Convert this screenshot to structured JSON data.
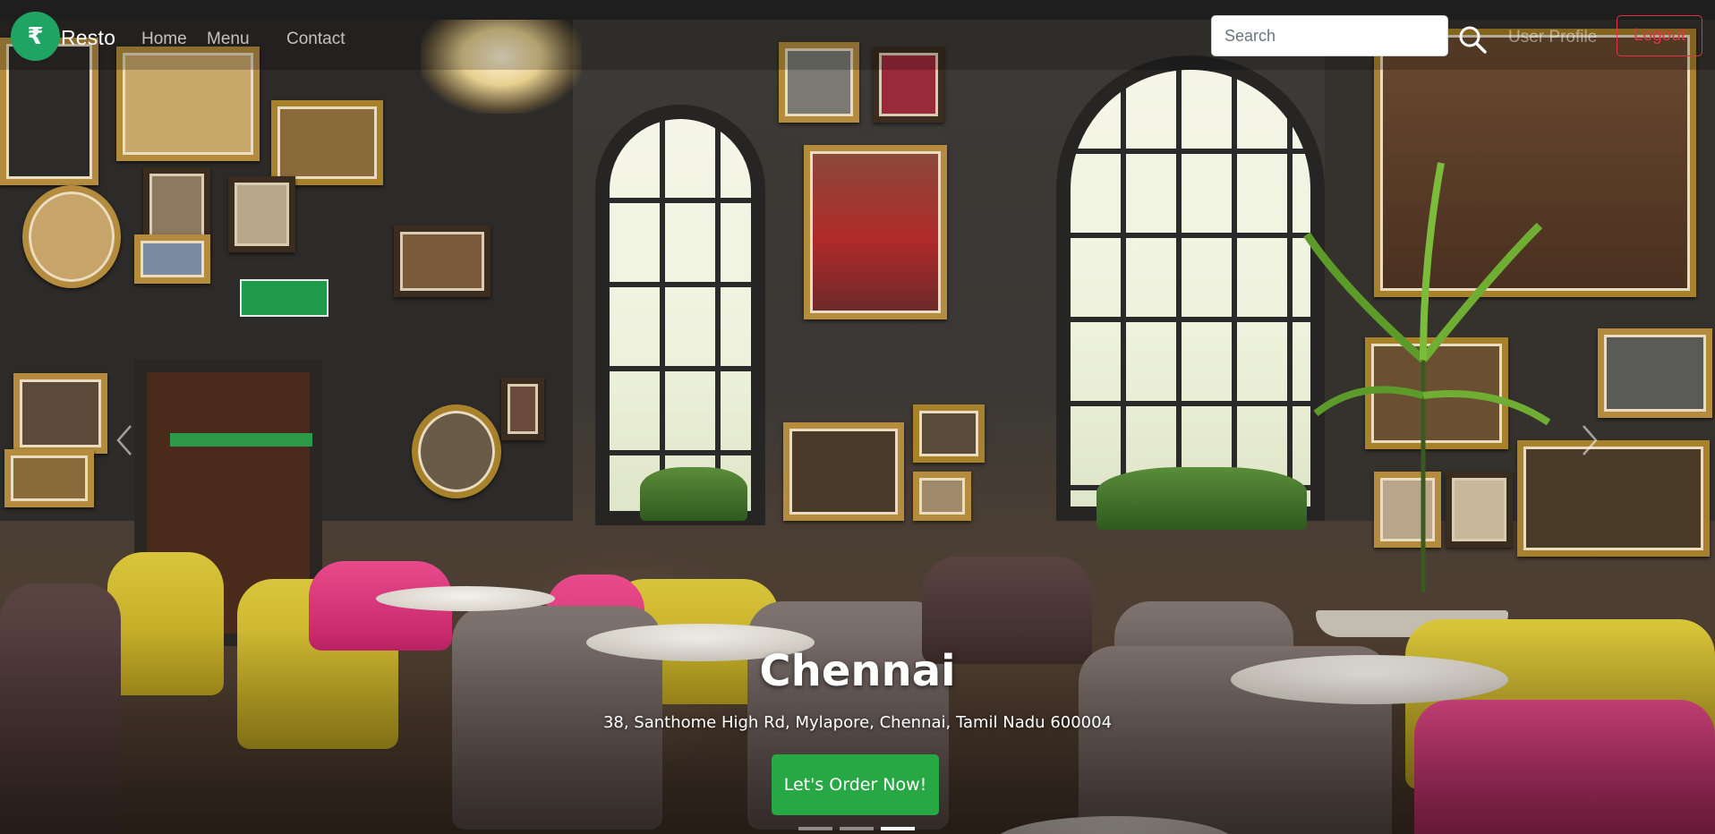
{
  "brand": {
    "name": "Resto",
    "logo_glyph": "₹",
    "logo_color": "#1fa463"
  },
  "nav": {
    "items": [
      {
        "label": "Home"
      },
      {
        "label": "Menu"
      },
      {
        "label": "Contact"
      }
    ]
  },
  "search": {
    "placeholder": "Search",
    "value": "",
    "icon": "search-icon"
  },
  "user": {
    "profile_label": "User Profile",
    "logout_label": "Logout"
  },
  "hero": {
    "city": "Chennai",
    "address": "38, Santhome High Rd, Mylapore, Chennai, Tamil Nadu 600004",
    "cta_label": "Let's Order Now!",
    "prev_icon": "chevron-left-icon",
    "next_icon": "chevron-right-icon",
    "slide_count": 3,
    "active_slide": 3
  },
  "colors": {
    "accent": "#28a745",
    "danger": "#dc3545"
  }
}
